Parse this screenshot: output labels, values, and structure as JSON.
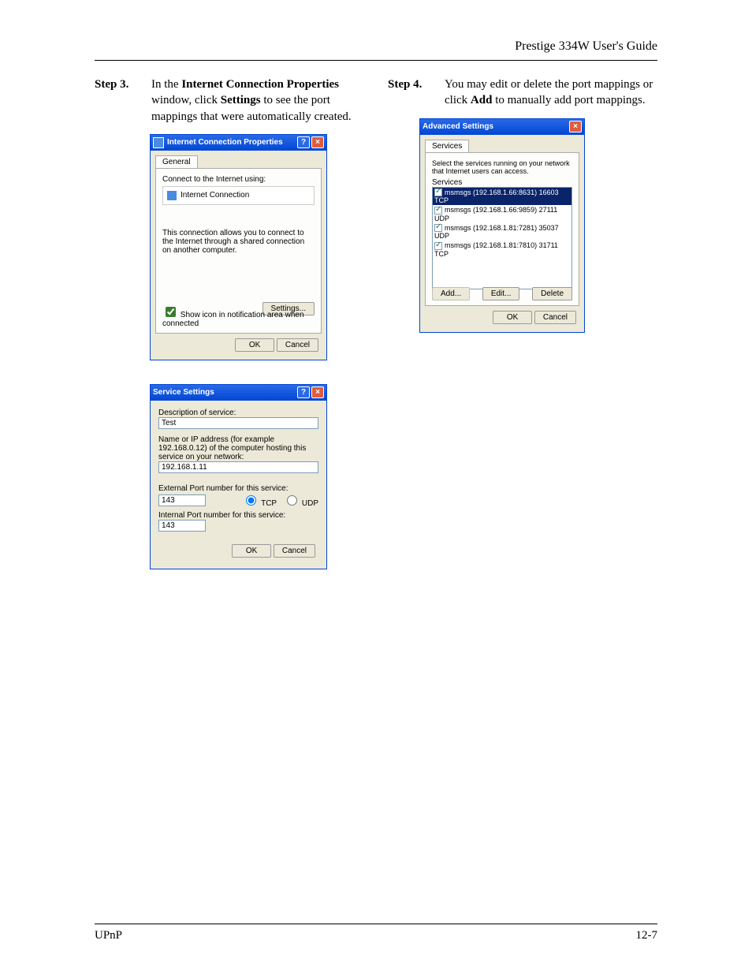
{
  "header": {
    "guide_title": "Prestige 334W User's Guide"
  },
  "step3": {
    "label": "Step 3.",
    "pre": "In the ",
    "bold1": "Internet Connection Properties",
    "mid1": " window, click ",
    "bold2": "Settings",
    "post": " to see the port mappings that were automatically created."
  },
  "step4": {
    "label": "Step 4.",
    "pre": "You may edit or delete the port mappings or click ",
    "bold1": "Add",
    "post": " to manually add port mappings."
  },
  "icp": {
    "title": "Internet Connection Properties",
    "tab": "General",
    "connect_label": "Connect to the Internet using:",
    "conn_item": "Internet Connection",
    "desc": "This connection allows you to connect to the Internet through a shared connection on another computer.",
    "settings_btn": "Settings...",
    "show_icon": "Show icon in notification area when connected",
    "ok": "OK",
    "cancel": "Cancel"
  },
  "ss": {
    "title": "Service Settings",
    "desc_lbl": "Description of service:",
    "desc_val": "Test",
    "ip_lbl": "Name or IP address (for example 192.168.0.12) of the computer hosting this service on your network:",
    "ip_val": "192.168.1.11",
    "ext_lbl": "External Port number for this service:",
    "ext_val": "143",
    "int_lbl": "Internal Port number for this service:",
    "int_val": "143",
    "tcp": "TCP",
    "udp": "UDP",
    "ok": "OK",
    "cancel": "Cancel"
  },
  "adv": {
    "title": "Advanced Settings",
    "tab": "Services",
    "instr": "Select the services running on your network that Internet users can access.",
    "list_lbl": "Services",
    "rows": {
      "r1": "msmsgs (192.168.1.66:8631) 16603 TCP",
      "r2": "msmsgs (192.168.1.66:9859) 27111 UDP",
      "r3": "msmsgs (192.168.1.81:7281) 35037 UDP",
      "r4": "msmsgs (192.168.1.81:7810) 31711 TCP"
    },
    "add": "Add...",
    "edit": "Edit...",
    "delete": "Delete",
    "ok": "OK",
    "cancel": "Cancel"
  },
  "footer": {
    "left": "UPnP",
    "right": "12-7"
  }
}
